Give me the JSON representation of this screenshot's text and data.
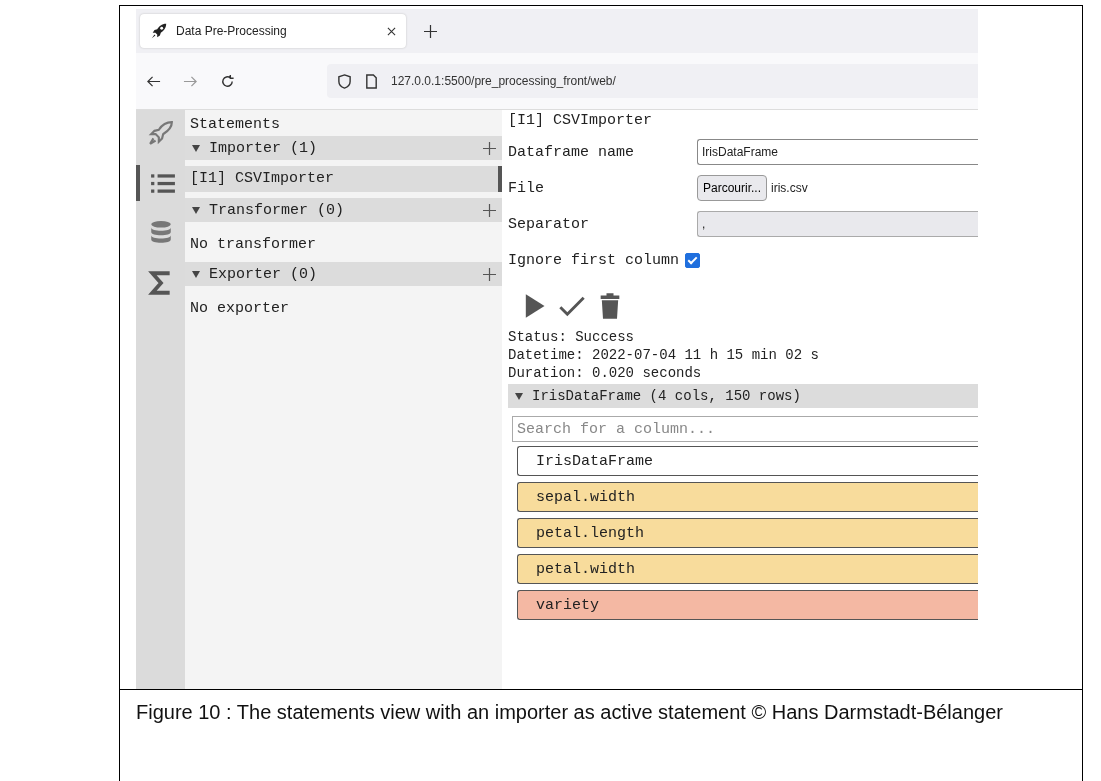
{
  "browser": {
    "tab": {
      "title": "Data Pre-Processing"
    },
    "url": "127.0.0.1:5500/pre_processing_front/web/"
  },
  "rail": [
    {
      "kind": "rocket",
      "selected": false
    },
    {
      "kind": "list",
      "selected": true
    },
    {
      "kind": "database",
      "selected": false
    },
    {
      "kind": "sigma",
      "selected": false
    }
  ],
  "statements": {
    "title": "Statements",
    "sections": [
      {
        "title": "Importer (1)",
        "expanded": true,
        "items": [
          {
            "label": "[I1] CSVImporter",
            "selected": true
          }
        ]
      },
      {
        "title": "Transformer (0)",
        "expanded": true,
        "empty": "No transformer"
      },
      {
        "title": "Exporter (0)",
        "expanded": true,
        "empty": "No exporter"
      }
    ]
  },
  "detail": {
    "title": "[I1] CSVImporter",
    "fields": [
      {
        "kind": "text",
        "label": "Dataframe name",
        "value": "IrisDataFrame"
      },
      {
        "kind": "file",
        "label": "File",
        "button": "Parcourir...",
        "value": "iris.csv"
      },
      {
        "kind": "select",
        "label": "Separator",
        "value": ","
      },
      {
        "kind": "checkbox",
        "label": "Ignore first column",
        "checked": true
      }
    ],
    "status": [
      "Status: Success",
      "Datetime: 2022-07-04 11 h 15 min 02 s",
      "Duration: 0.020 seconds"
    ],
    "dataframe": {
      "title": "IrisDataFrame (4 cols, 150 rows)",
      "expanded": true,
      "search": {
        "placeholder": "Search for a column..."
      },
      "columns": [
        {
          "name": "IrisDataFrame",
          "color": "#ffffff"
        },
        {
          "name": "sepal.width",
          "color": "#f8dc9c"
        },
        {
          "name": "petal.length",
          "color": "#f8dc9c"
        },
        {
          "name": "petal.width",
          "color": "#f8dc9c"
        },
        {
          "name": "variety",
          "color": "#f4b8a3"
        }
      ]
    }
  },
  "caption": "Figure 10 : The statements view with an importer as active statement © Hans Darmstadt-Bélanger"
}
